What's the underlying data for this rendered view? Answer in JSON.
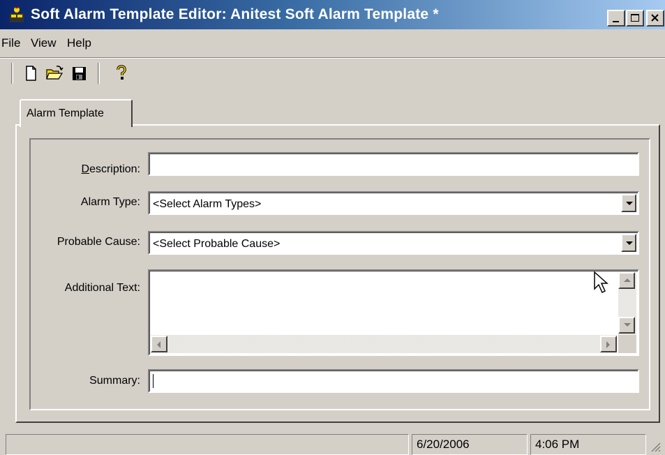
{
  "window": {
    "title": "Soft Alarm Template Editor: Anitest Soft Alarm Template *"
  },
  "menu": [
    "File",
    "View",
    "Help"
  ],
  "toolbar": {
    "buttons": [
      "new-document-icon",
      "open-folder-icon",
      "save-icon",
      "help-icon"
    ]
  },
  "tab": {
    "label": "Alarm Template"
  },
  "form": {
    "description": {
      "label_accel": "D",
      "label_rest": "escription:",
      "value": ""
    },
    "alarm_type": {
      "label": "Alarm Type:",
      "value": "<Select Alarm Types>"
    },
    "probable_cause": {
      "label": "Probable Cause:",
      "value": "<Select Probable Cause>"
    },
    "additional_text": {
      "label": "Additional Text:",
      "value": ""
    },
    "summary": {
      "label": "Summary:",
      "value": ""
    }
  },
  "status": {
    "message": "",
    "date": "6/20/2006",
    "time": "4:06 PM"
  },
  "colors": {
    "title_gradient_start": "#0a246a",
    "title_gradient_end": "#a6caf0",
    "face": "#d4d0c8"
  }
}
